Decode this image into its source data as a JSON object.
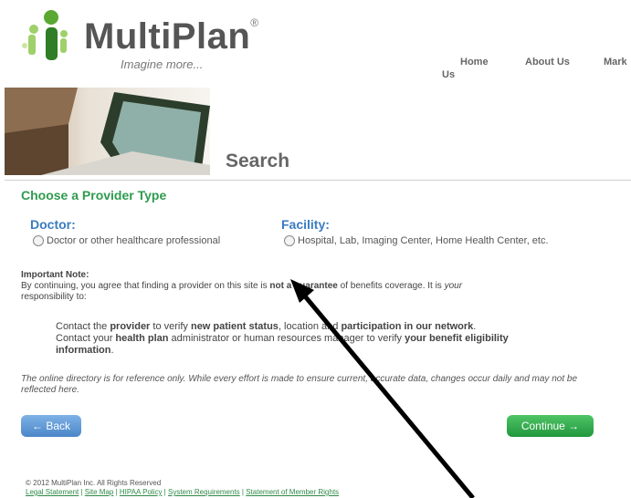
{
  "header": {
    "logo_name": "MultiPlan",
    "logo_reg": "®",
    "tagline": "Imagine more...",
    "nav": [
      "Home",
      "About Us",
      "Mark",
      "Us"
    ]
  },
  "page_title": "Search",
  "section_title": "Choose a Provider Type",
  "provider_types": {
    "doctor": {
      "heading": "Doctor:",
      "option": "Doctor or other healthcare professional"
    },
    "facility": {
      "heading": "Facility:",
      "option": "Hospital, Lab, Imaging Center, Home Health Center, etc."
    }
  },
  "important_note": {
    "label": "Important Note:",
    "line1_pre": "By continuing, you agree that finding a provider on this site is ",
    "line1_bold": "not a guarantee",
    "line1_post": " of benefits coverage. It is ",
    "line1_italic": "your",
    "line2": "responsibility to:"
  },
  "bullets": [
    [
      "Contact the ",
      "provider",
      " to verify ",
      "new patient status",
      ", location and ",
      "participation in our network",
      "."
    ],
    [
      "Contact your ",
      "health plan",
      " administrator or human resources manager to verify ",
      "your benefit eligibility information",
      "."
    ]
  ],
  "disclaimer": "The online directory is for reference only. While every effort is made to ensure current, accurate data, changes occur daily and may not be reflected here.",
  "buttons": {
    "back": "← Back",
    "continue": "Continue →"
  },
  "footer": {
    "copyright": "© 2012 MultiPlan Inc. All Rights Reserved",
    "links": [
      "Legal Statement",
      "Site Map",
      "HIPAA Policy",
      "System Requirements",
      "Statement of Member Rights"
    ]
  },
  "colors": {
    "green": "#2e9b4e",
    "blue": "#3a7cc0",
    "continue_btn": "#21963c",
    "back_btn": "#4a86c8"
  },
  "icons": {
    "logo": "multiplan-people-logo-icon",
    "annotation": "arrow-icon"
  }
}
